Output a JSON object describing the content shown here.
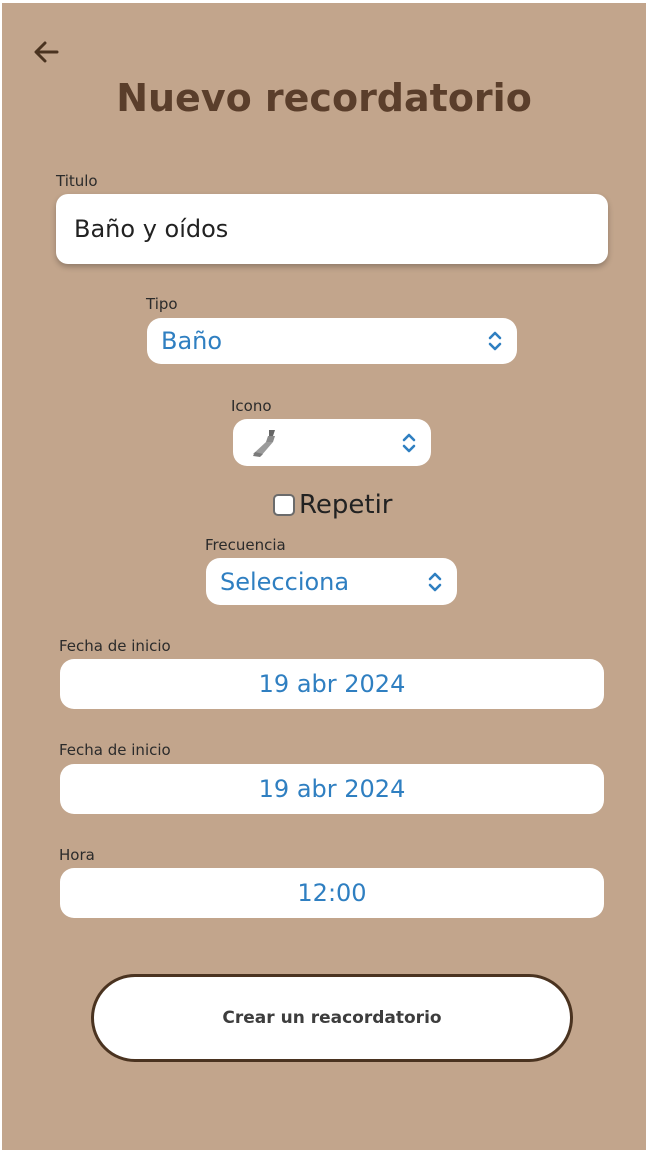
{
  "header": {
    "back_icon": "arrow-left-icon",
    "title": "Nuevo recordatorio"
  },
  "form": {
    "titulo": {
      "label": "Titulo",
      "value": "Baño y oídos"
    },
    "tipo": {
      "label": "Tipo",
      "value": "Baño"
    },
    "icono": {
      "label": "Icono",
      "value_icon": "brush-icon"
    },
    "repetir": {
      "label": "Repetir",
      "checked": false
    },
    "frecuencia": {
      "label": "Frecuencia",
      "value": "Selecciona"
    },
    "fecha_inicio_1": {
      "label": "Fecha de inicio",
      "value": "19 abr 2024"
    },
    "fecha_inicio_2": {
      "label": "Fecha de inicio",
      "value": "19 abr 2024"
    },
    "hora": {
      "label": "Hora",
      "value": "12:00"
    }
  },
  "actions": {
    "create_label": "Crear un reacordatorio"
  },
  "colors": {
    "background": "#c2a58c",
    "title": "#5a3e2b",
    "accent_blue": "#2f7fc1",
    "button_border": "#4a3320"
  }
}
